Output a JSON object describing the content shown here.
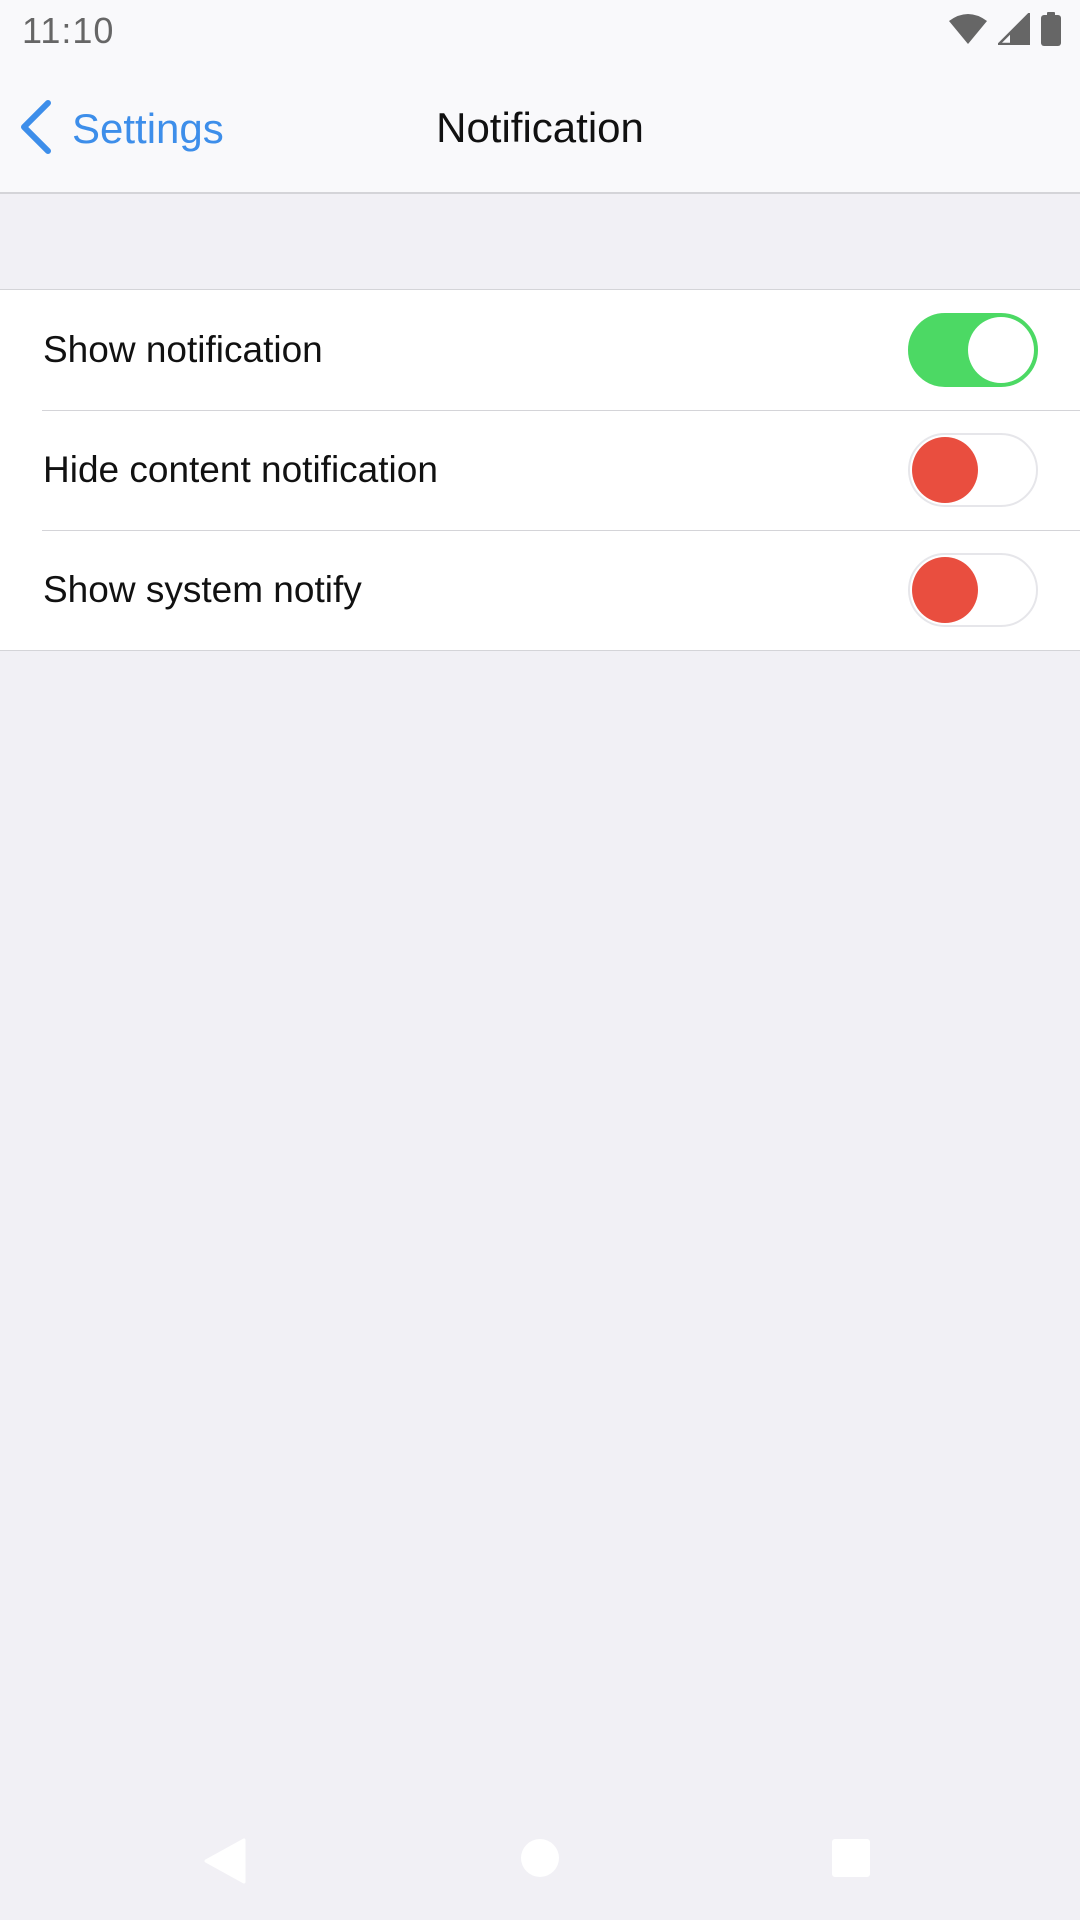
{
  "status_bar": {
    "time": "11:10",
    "icons": [
      "wifi-icon",
      "cellular-signal-icon",
      "battery-icon"
    ]
  },
  "nav_bar": {
    "back_label": "Settings",
    "title": "Notification"
  },
  "settings": {
    "items": [
      {
        "label": "Show notification",
        "state": "on"
      },
      {
        "label": "Hide content notification",
        "state": "off"
      },
      {
        "label": "Show system notify",
        "state": "off"
      }
    ]
  },
  "android_nav": {
    "icons": [
      "back-triangle-icon",
      "home-circle-icon",
      "recents-square-icon"
    ]
  },
  "colors": {
    "accent": "#3d8eea",
    "toggle_on": "#4cd964",
    "toggle_off_knob": "#e94e3f",
    "background": "#f1f0f5",
    "bar_background": "#f9f9fb",
    "separator": "#d4d4d8"
  }
}
